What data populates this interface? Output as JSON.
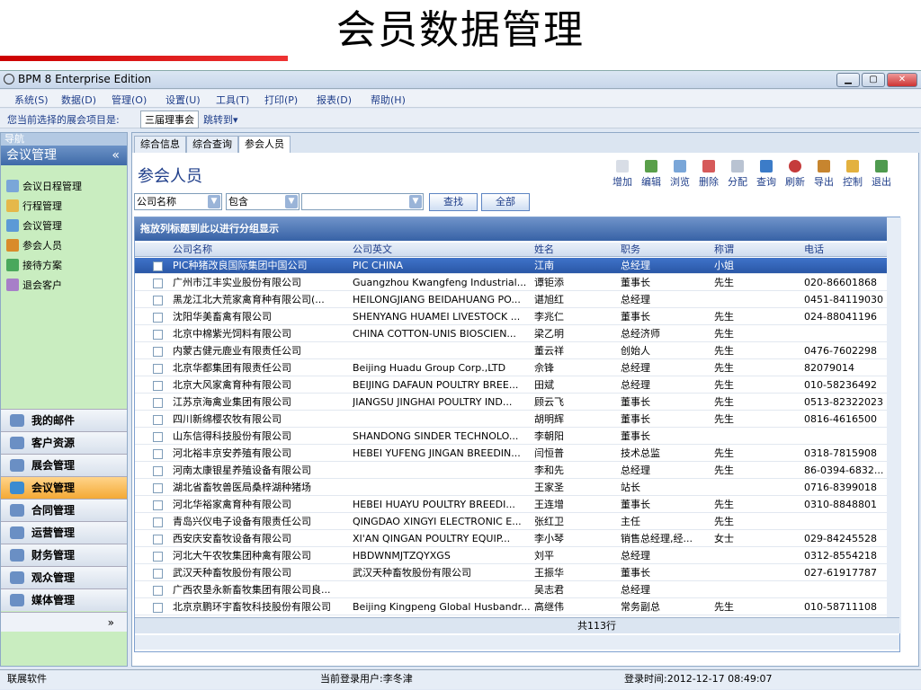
{
  "slide": {
    "title": "会员数据管理"
  },
  "window": {
    "title": "BPM 8 Enterprise Edition"
  },
  "menu": [
    "系统(S)",
    "数据(D)",
    "管理(O)",
    "设置(U)",
    "工具(T)",
    "打印(P)",
    "报表(D)",
    "帮助(H)"
  ],
  "project": {
    "label": "您当前选择的展会项目是:",
    "value": "三届理事会",
    "jump": "跳转到▾"
  },
  "nav": {
    "header": "导航",
    "group": "会议管理",
    "collapse": "«",
    "items": [
      "会议日程管理",
      "行程管理",
      "会议管理",
      "参会人员",
      "接待方案",
      "退会客户"
    ],
    "modules": [
      "我的邮件",
      "客户资源",
      "展会管理",
      "会议管理",
      "合同管理",
      "运营管理",
      "财务管理",
      "观众管理",
      "媒体管理"
    ],
    "more": "»"
  },
  "tabs": [
    "综合信息",
    "综合查询",
    "参会人员"
  ],
  "page": {
    "title": "参会人员"
  },
  "toolbar": [
    "增加",
    "编辑",
    "浏览",
    "删除",
    "分配",
    "查询",
    "刷新",
    "导出",
    "控制",
    "退出"
  ],
  "filter": {
    "field": "公司名称",
    "op": "包含",
    "value": "",
    "find": "查找",
    "all": "全部"
  },
  "grid": {
    "group_hint": "拖放列标题到此以进行分组显示",
    "columns": [
      "公司名称",
      "公司英文",
      "姓名",
      "职务",
      "称谓",
      "电话"
    ],
    "rows": [
      [
        "PIC种猪改良国际集团中国公司",
        "PIC CHINA",
        "江南",
        "总经理",
        "小姐",
        ""
      ],
      [
        "广州市江丰实业股份有限公司",
        "Guangzhou Kwangfeng Industrial...",
        "谭钜添",
        "董事长",
        "先生",
        "020-86601868"
      ],
      [
        "黑龙江北大荒家禽育种有限公司(...",
        "HEILONGJIANG BEIDAHUANG PO...",
        "谌旭红",
        "总经理",
        "",
        "0451-84119030"
      ],
      [
        "沈阳华美畜禽有限公司",
        "SHENYANG HUAMEI LIVESTOCK ...",
        "李兆仁",
        "董事长",
        "先生",
        "024-88041196"
      ],
      [
        "北京中棉紫光饲料有限公司",
        "CHINA COTTON-UNIS BIOSCIEN...",
        "梁乙明",
        "总经济师",
        "先生",
        ""
      ],
      [
        "内蒙古健元鹿业有限责任公司",
        "",
        "董云祥",
        "创始人",
        "先生",
        "0476-7602298"
      ],
      [
        "北京华都集团有限责任公司",
        "Beijing Huadu Group Corp.,LTD",
        "佘锋",
        "总经理",
        "先生",
        "82079014"
      ],
      [
        "北京大风家禽育种有限公司",
        "BEIJING DAFAUN POULTRY BREE...",
        "田斌",
        "总经理",
        "先生",
        "010-58236492"
      ],
      [
        "江苏京海禽业集团有限公司",
        "JIANGSU JINGHAI POULTRY IND...",
        "顾云飞",
        "董事长",
        "先生",
        "0513-82322023"
      ],
      [
        "四川新绵樱农牧有限公司",
        "",
        "胡明辉",
        "董事长",
        "先生",
        "0816-4616500"
      ],
      [
        "山东信得科技股份有限公司",
        "SHANDONG SINDER TECHNOLO...",
        "李朝阳",
        "董事长",
        "",
        ""
      ],
      [
        "河北裕丰京安养殖有限公司",
        "HEBEI YUFENG JINGAN BREEDIN...",
        "闫恒普",
        "技术总监",
        "先生",
        "0318-7815908"
      ],
      [
        "河南太康银星养殖设备有限公司",
        "",
        "李和先",
        "总经理",
        "先生",
        "86-0394-6832..."
      ],
      [
        "湖北省畜牧兽医局桑梓湖种猪场",
        "",
        "王家圣",
        "站长",
        "",
        "0716-8399018"
      ],
      [
        "河北华裕家禽育种有限公司",
        "HEBEI HUAYU POULTRY BREEDI...",
        "王连增",
        "董事长",
        "先生",
        "0310-8848801"
      ],
      [
        "青岛兴仪电子设备有限责任公司",
        "QINGDAO XINGYI ELECTRONIC E...",
        "张红卫",
        "主任",
        "先生",
        ""
      ],
      [
        "西安庆安畜牧设备有限公司",
        "XI'AN QINGAN POULTRY EQUIP...",
        "李小琴",
        "销售总经理,经...",
        "女士",
        "029-84245528"
      ],
      [
        "河北大午农牧集团种禽有限公司",
        "HBDWNMJTZQYXGS",
        "刘平",
        "总经理",
        "",
        "0312-8554218"
      ],
      [
        "武汉天种畜牧股份有限公司",
        "武汉天种畜牧股份有限公司",
        "王振华",
        "董事长",
        "",
        "027-61917787"
      ],
      [
        "广西农垦永新畜牧集团有限公司良...",
        "",
        "吴志君",
        "总经理",
        "",
        ""
      ],
      [
        "北京京鹏环宇畜牧科技股份有限公司",
        "Beijing Kingpeng Global Husbandr...",
        "高继伟",
        "常务副总",
        "先生",
        "010-58711108"
      ]
    ],
    "footer": "共113行"
  },
  "status": {
    "company": "联展软件",
    "user": "当前登录用户:李冬津",
    "time": "登录时间:2012-12-17 08:49:07"
  }
}
